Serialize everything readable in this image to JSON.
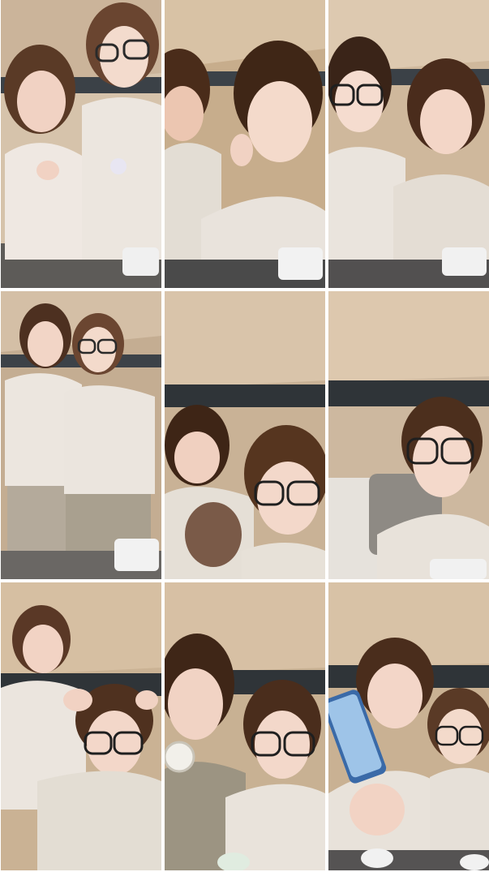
{
  "grid": {
    "rows": 3,
    "columns": 3
  },
  "frames": [
    {
      "id": "r1c1",
      "wall": "#d6c3ab",
      "ceiling": "#cbb49a",
      "pajama": "#efe8e2",
      "hair": "#5a3a26"
    },
    {
      "id": "r1c2",
      "wall": "#c7ad8c",
      "ceiling": "#d8c2a5",
      "pajama": "#e9e3dc",
      "hair": "#4a2c1a"
    },
    {
      "id": "r1c3",
      "wall": "#cfb89c",
      "ceiling": "#ddc9b0",
      "pajama": "#eae4dd",
      "hair": "#3a2418"
    },
    {
      "id": "r2c1",
      "wall": "#c4ad92",
      "ceiling": "#d4bfa6",
      "pajama": "#ece6df",
      "hair": "#4d3020"
    },
    {
      "id": "r2c2",
      "wall": "#c9b296",
      "ceiling": "#d9c4aa",
      "pajama": "#e7e1d8",
      "hair": "#3e2516"
    },
    {
      "id": "r2c3",
      "wall": "#cdb89f",
      "ceiling": "#ddc8ae",
      "pajama": "#e8e2da",
      "hair": "#4c2f1d"
    },
    {
      "id": "r3c1",
      "wall": "#cab294",
      "ceiling": "#d6bfa2",
      "pajama": "#ebe5de",
      "hair": "#5a3826"
    },
    {
      "id": "r3c2",
      "wall": "#c8b193",
      "ceiling": "#d7c0a4",
      "pajama": "#e9e3db",
      "hair": "#3f2617"
    },
    {
      "id": "r3c3",
      "wall": "#c9b193",
      "ceiling": "#d8c2a6",
      "pajama": "#e8e2da",
      "hair": "#4a2d1c"
    }
  ]
}
